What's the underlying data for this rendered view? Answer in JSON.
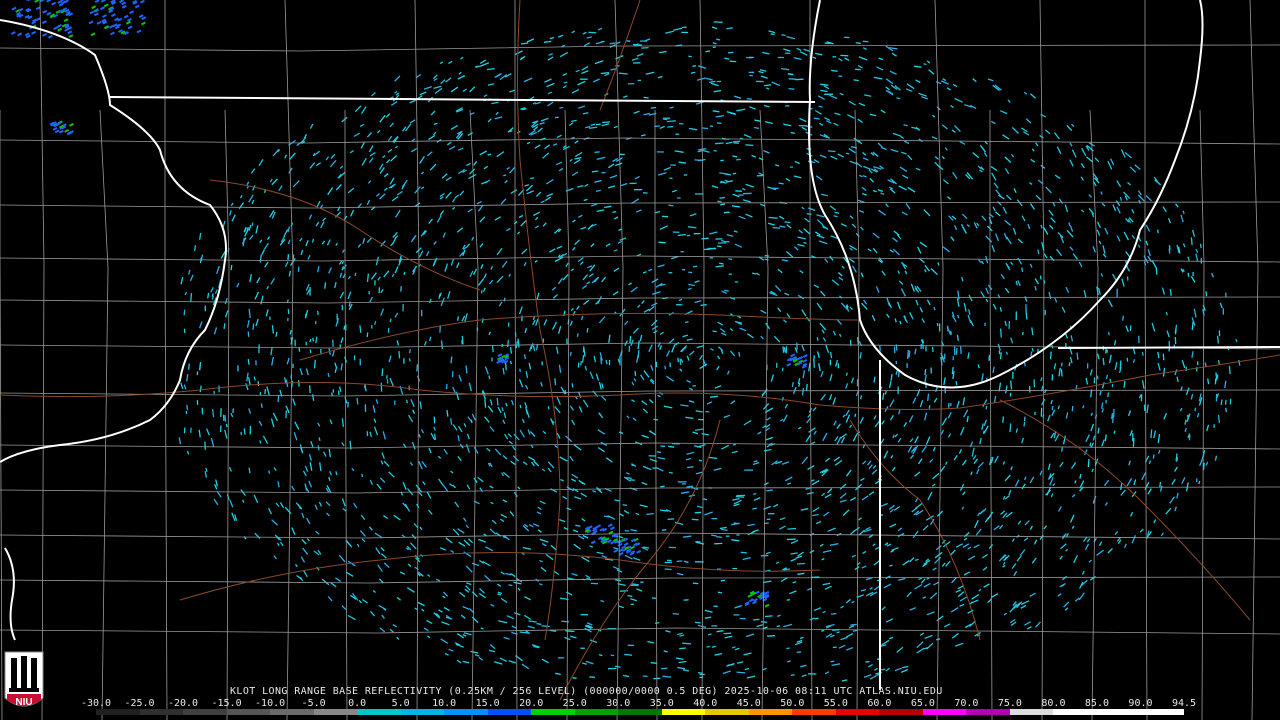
{
  "header": {
    "caption": "KLOT LONG RANGE BASE REFLECTIVITY (0.25KM / 256 LEVEL) (000000/0000 0.5 DEG) 2025-10-06 08:11 UTC  ATLAS.NIU.EDU"
  },
  "logo": {
    "text": "NIU"
  },
  "legend": {
    "values": [
      "-30.0",
      "-25.0",
      "-20.0",
      "-15.0",
      "-10.0",
      "-5.0",
      "0.0",
      "5.0",
      "10.0",
      "15.0",
      "20.0",
      "25.0",
      "30.0",
      "35.0",
      "40.0",
      "45.0",
      "50.0",
      "55.0",
      "60.0",
      "65.0",
      "70.0",
      "75.0",
      "80.0",
      "85.0",
      "90.0",
      "94.5"
    ],
    "colors": [
      "#202020",
      "#303030",
      "#404040",
      "#555555",
      "#6a6a6a",
      "#888888",
      "#00c8c8",
      "#00b4e6",
      "#0090ff",
      "#0050ff",
      "#00d200",
      "#00a000",
      "#007800",
      "#ffff00",
      "#e6c800",
      "#ff9600",
      "#ff3c00",
      "#e60000",
      "#b40000",
      "#ff00ff",
      "#b400b4",
      "#dcdcdc",
      "#ffffff",
      "#ffffff",
      "#ffffff"
    ]
  },
  "colors": {
    "background": "#000000",
    "state_border": "#ffffff",
    "county_border": "#9a9a9a",
    "road": "#8b4a2b",
    "echo_main": "#1ec8dc",
    "echo_light": "#2ab0e6",
    "echo_strong": "#1e64ff"
  }
}
